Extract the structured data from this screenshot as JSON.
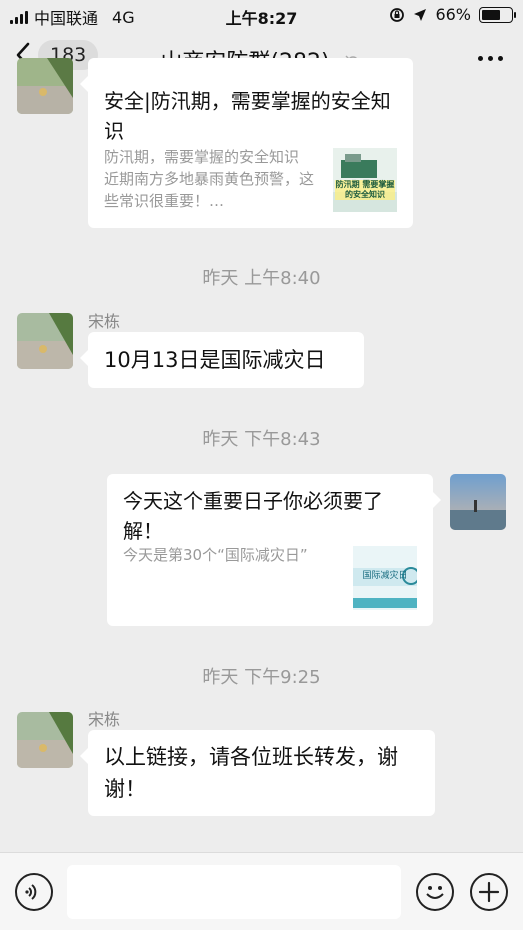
{
  "status": {
    "carrier": "中国联通",
    "network": "4G",
    "time": "上午8:27",
    "battery": "66%",
    "battery_level": 0.66
  },
  "nav": {
    "back_count": "183",
    "title": "山商安防群(282)"
  },
  "messages": {
    "card1": {
      "title": "安全|防汛期，需要掌握的安全知识",
      "desc": "防汛期，需要掌握的安全知识　近期南方多地暴雨黄色预警，这些常识很重要！…",
      "thumb_text": "防汛期 需要掌握的安全知识"
    },
    "ts1": "昨天 上午8:40",
    "msg1": {
      "sender": "宋栋",
      "text": "10月13日是国际减灾日"
    },
    "ts2": "昨天 下午8:43",
    "card2": {
      "title": "今天这个重要日子你必须要了解！",
      "desc": "今天是第30个“国际减灾日”",
      "thumb_text": "国际减灾日"
    },
    "ts3": "昨天 下午9:25",
    "msg2": {
      "sender": "宋栋",
      "text": "以上链接，请各位班长转发，谢谢！"
    }
  },
  "colors": {
    "background": "#ededed",
    "bubble": "#ffffff",
    "timestamp": "#999999"
  }
}
